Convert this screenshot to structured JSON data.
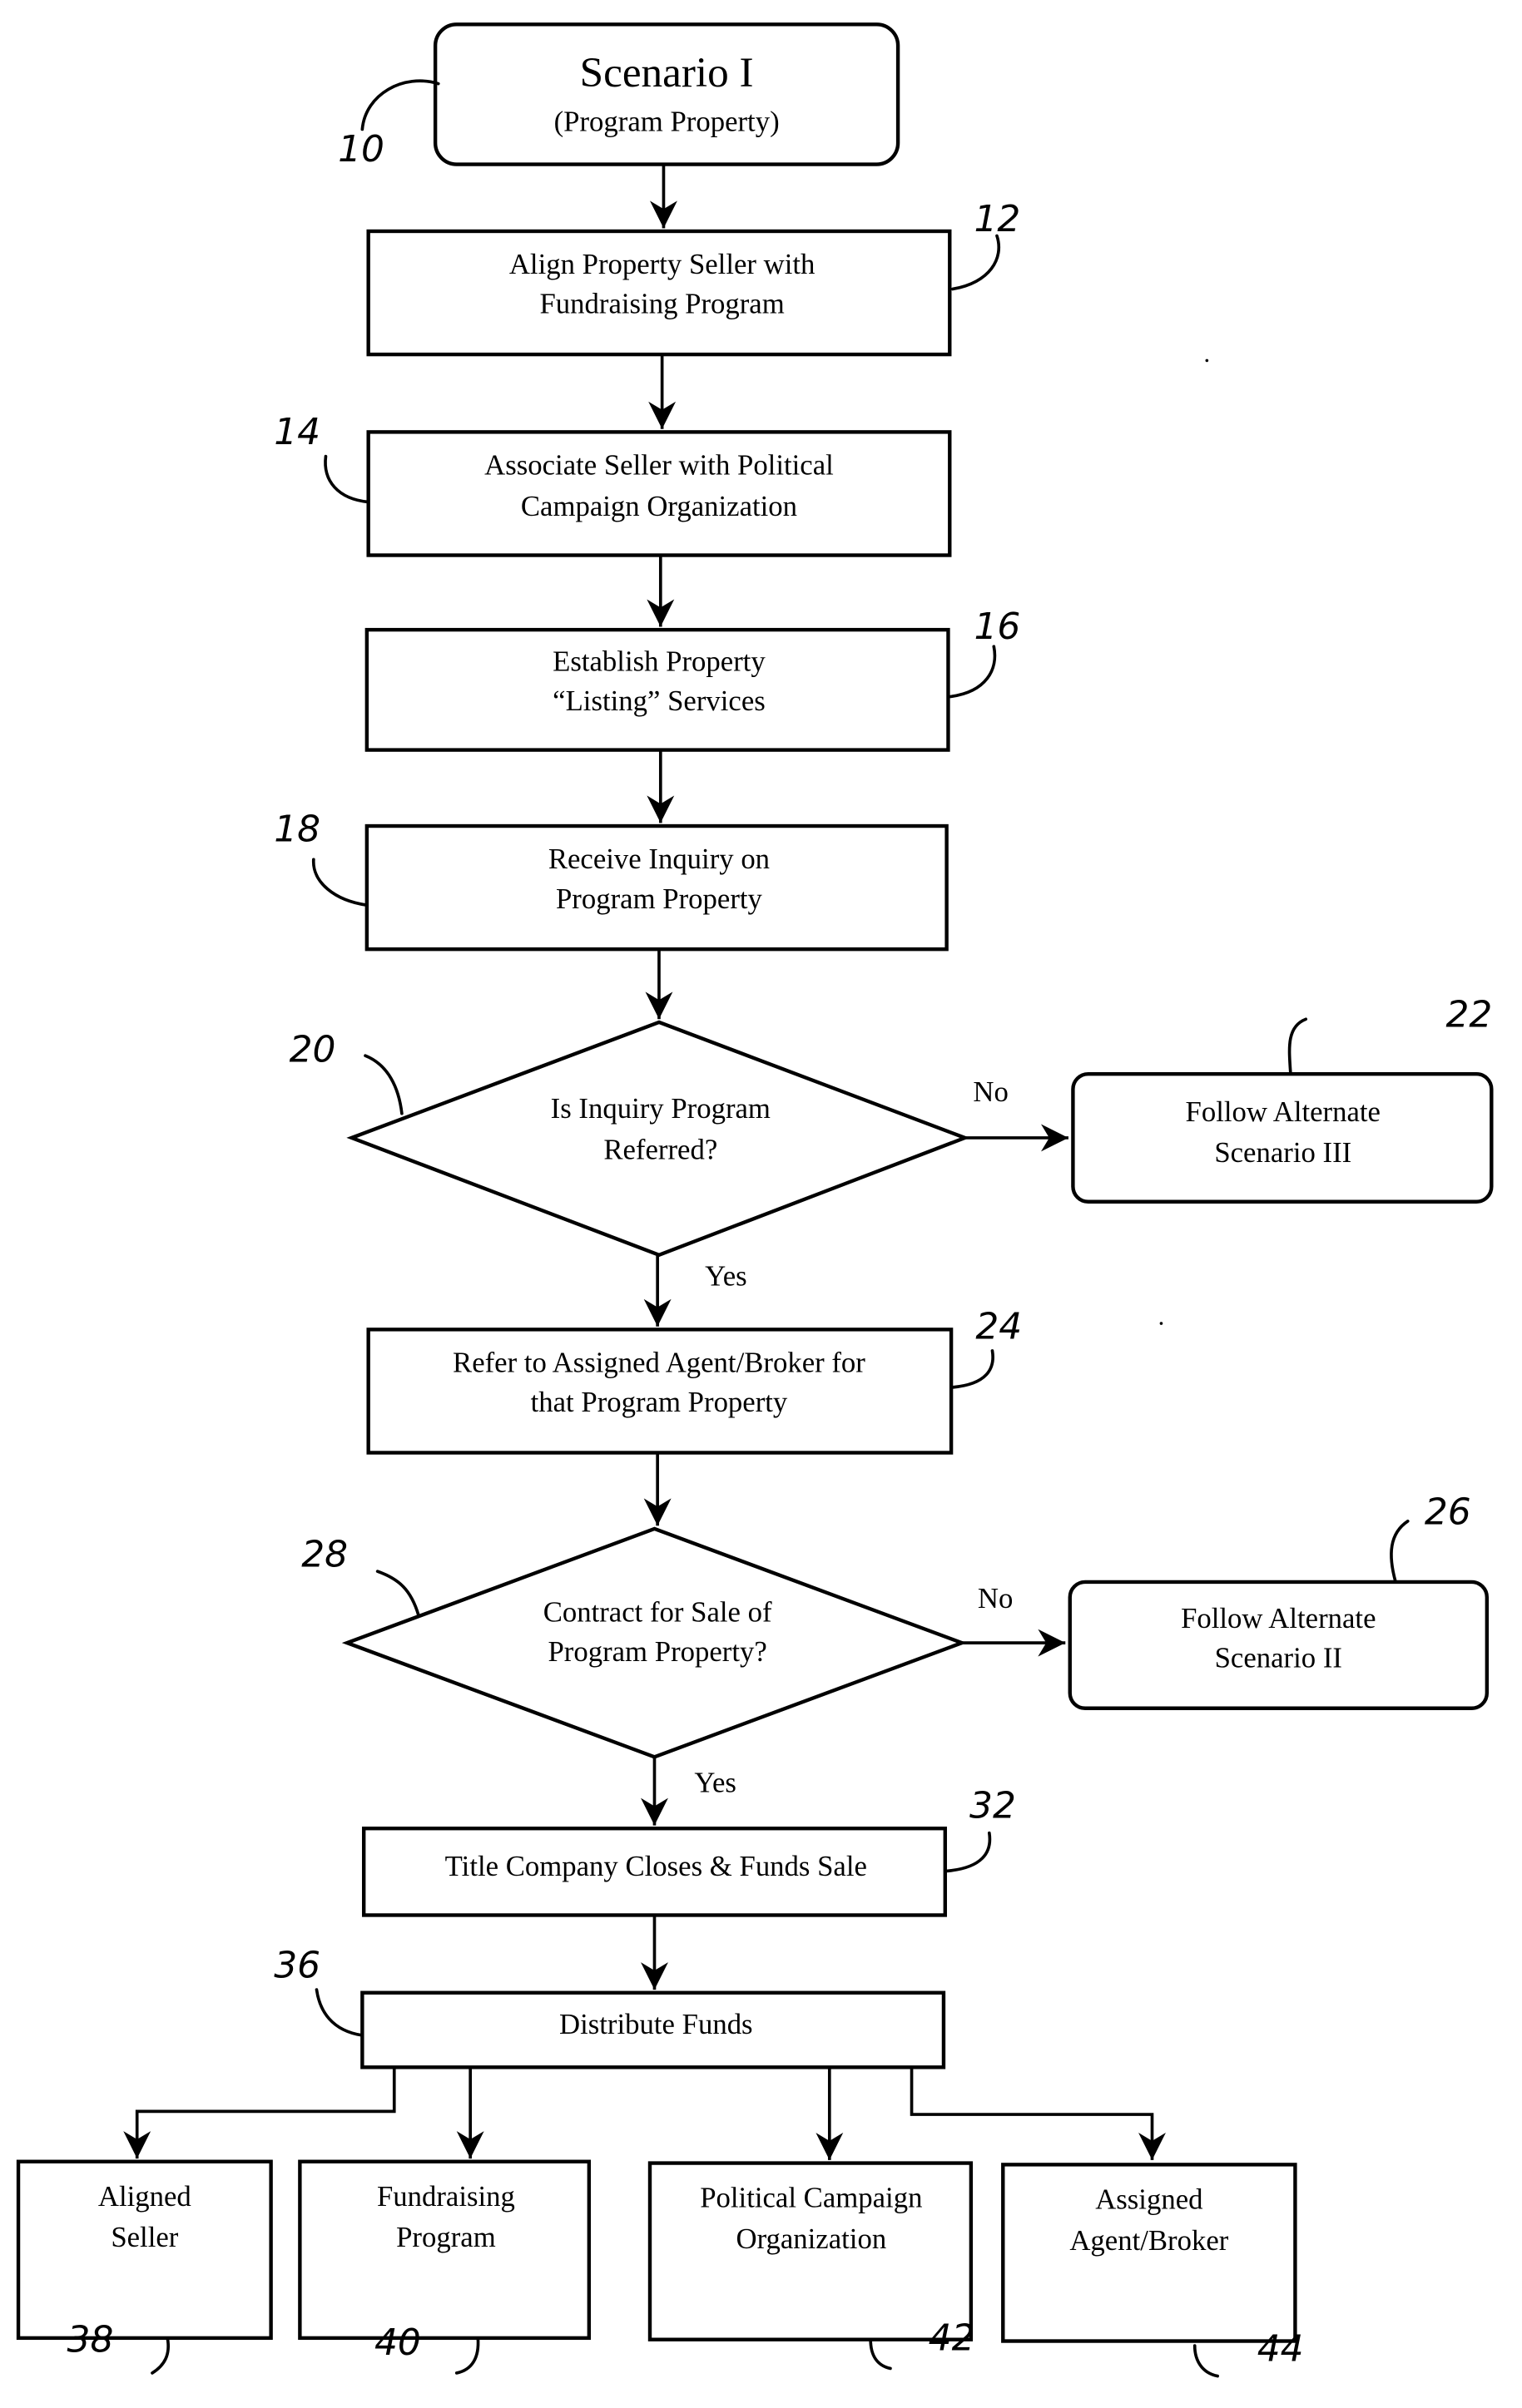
{
  "diagram": {
    "start": {
      "ref": "10",
      "title": "Scenario I",
      "subtitle": "(Program Property)"
    },
    "steps": [
      {
        "ref": "12",
        "lines": [
          "Align Property Seller with",
          "Fundraising Program"
        ]
      },
      {
        "ref": "14",
        "lines": [
          "Associate Seller with Political",
          "Campaign Organization"
        ]
      },
      {
        "ref": "16",
        "lines": [
          "Establish Property",
          "“Listing” Services"
        ]
      },
      {
        "ref": "18",
        "lines": [
          "Receive Inquiry on",
          "Program Property"
        ]
      }
    ],
    "decision1": {
      "ref": "20",
      "lines": [
        "Is Inquiry Program",
        "Referred?"
      ],
      "no_label": "No",
      "yes_label": "Yes"
    },
    "alt1": {
      "ref": "22",
      "lines": [
        "Follow Alternate",
        "Scenario III"
      ]
    },
    "step24": {
      "ref": "24",
      "lines": [
        "Refer to Assigned Agent/Broker for",
        "that Program Property"
      ]
    },
    "decision2": {
      "ref": "28",
      "lines": [
        "Contract for Sale of",
        "Program Property?"
      ],
      "no_label": "No",
      "yes_label": "Yes"
    },
    "alt2": {
      "ref": "26",
      "lines": [
        "Follow Alternate",
        "Scenario II"
      ]
    },
    "step32": {
      "ref": "32",
      "lines": [
        "Title Company Closes & Funds Sale"
      ]
    },
    "step36": {
      "ref": "36",
      "lines": [
        "Distribute Funds"
      ]
    },
    "recipients": [
      {
        "ref": "38",
        "lines": [
          "Aligned",
          "Seller"
        ]
      },
      {
        "ref": "40",
        "lines": [
          "Fundraising",
          "Program"
        ]
      },
      {
        "ref": "42",
        "lines": [
          "Political Campaign",
          "Organization"
        ]
      },
      {
        "ref": "44",
        "lines": [
          "Assigned",
          "Agent/Broker"
        ]
      }
    ]
  }
}
